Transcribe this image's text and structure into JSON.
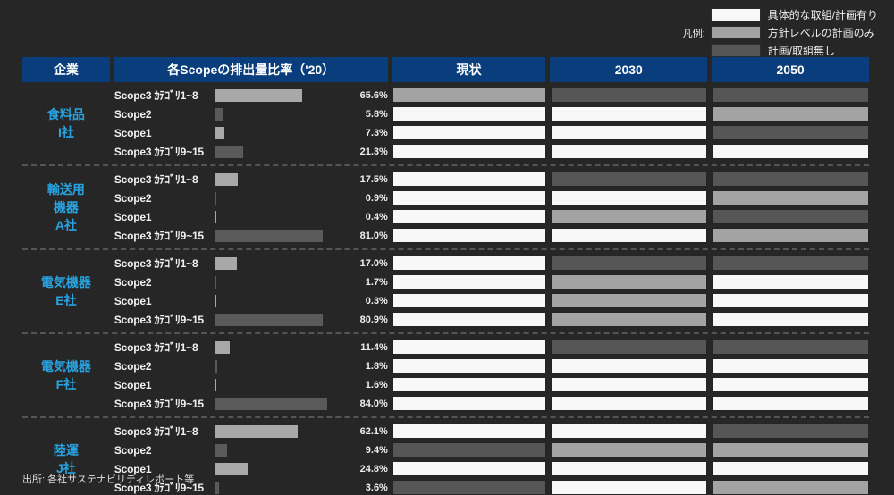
{
  "legend": {
    "label": "凡例:",
    "items": [
      {
        "text": "具体的な取組/計画有り",
        "color": "#f8f8f8"
      },
      {
        "text": "方針レベルの計画のみ",
        "color": "#a3a3a3"
      },
      {
        "text": "計画/取組無し",
        "color": "#565656"
      }
    ]
  },
  "colors": {
    "header_blue": "#0a3d7c",
    "company_label": "#29a3e0",
    "background": "#262626",
    "bar_light": "#a8a8a8",
    "bar_dark": "#5a5a5a",
    "status_yes": "#f8f8f8",
    "status_policy": "#a3a3a3",
    "status_none": "#565656"
  },
  "headers": {
    "company": "企業",
    "chart": "各Scopeの排出量比率（'20）",
    "now": "現状",
    "y2030": "2030",
    "y2050": "2050"
  },
  "source": "出所: 各社サステナビリティレポート等",
  "chart_data": {
    "type": "bar",
    "title": "各Scopeの排出量比率（'20）",
    "xlabel": "",
    "ylabel": "",
    "xlim": [
      0,
      100
    ],
    "grid": false,
    "orientation": "horizontal",
    "categories": [
      "Scope3 ｶﾃｺﾞﾘ1~8",
      "Scope2",
      "Scope1",
      "Scope3 ｶﾃｺﾞﾘ9~15"
    ],
    "groups": [
      {
        "company": [
          "食料品",
          "I社"
        ],
        "rows": [
          {
            "label": "Scope3 ｶﾃｺﾞﾘ1~8",
            "value": 65.6,
            "value_text": "65.6%",
            "bar_color": "#a8a8a8",
            "now": "#a3a3a3",
            "y2030": "#565656",
            "y2050": "#565656"
          },
          {
            "label": "Scope2",
            "value": 5.8,
            "value_text": "5.8%",
            "bar_color": "#5a5a5a",
            "now": "#f8f8f8",
            "y2030": "#f8f8f8",
            "y2050": "#a3a3a3"
          },
          {
            "label": "Scope1",
            "value": 7.3,
            "value_text": "7.3%",
            "bar_color": "#a8a8a8",
            "now": "#f8f8f8",
            "y2030": "#f8f8f8",
            "y2050": "#565656"
          },
          {
            "label": "Scope3 ｶﾃｺﾞﾘ9~15",
            "value": 21.3,
            "value_text": "21.3%",
            "bar_color": "#5a5a5a",
            "now": "#f8f8f8",
            "y2030": "#f8f8f8",
            "y2050": "#f8f8f8"
          }
        ]
      },
      {
        "company": [
          "輸送用",
          "機器",
          "A社"
        ],
        "rows": [
          {
            "label": "Scope3 ｶﾃｺﾞﾘ1~8",
            "value": 17.5,
            "value_text": "17.5%",
            "bar_color": "#a8a8a8",
            "now": "#f8f8f8",
            "y2030": "#565656",
            "y2050": "#565656"
          },
          {
            "label": "Scope2",
            "value": 0.9,
            "value_text": "0.9%",
            "bar_color": "#5a5a5a",
            "now": "#f8f8f8",
            "y2030": "#f8f8f8",
            "y2050": "#a3a3a3"
          },
          {
            "label": "Scope1",
            "value": 0.4,
            "value_text": "0.4%",
            "bar_color": "#a8a8a8",
            "now": "#f8f8f8",
            "y2030": "#a3a3a3",
            "y2050": "#565656"
          },
          {
            "label": "Scope3 ｶﾃｺﾞﾘ9~15",
            "value": 81.0,
            "value_text": "81.0%",
            "bar_color": "#5a5a5a",
            "now": "#f8f8f8",
            "y2030": "#f8f8f8",
            "y2050": "#a3a3a3"
          }
        ]
      },
      {
        "company": [
          "電気機器",
          "E社"
        ],
        "rows": [
          {
            "label": "Scope3 ｶﾃｺﾞﾘ1~8",
            "value": 17.0,
            "value_text": "17.0%",
            "bar_color": "#a8a8a8",
            "now": "#f8f8f8",
            "y2030": "#565656",
            "y2050": "#565656"
          },
          {
            "label": "Scope2",
            "value": 1.7,
            "value_text": "1.7%",
            "bar_color": "#5a5a5a",
            "now": "#f8f8f8",
            "y2030": "#a3a3a3",
            "y2050": "#f8f8f8"
          },
          {
            "label": "Scope1",
            "value": 0.3,
            "value_text": "0.3%",
            "bar_color": "#a8a8a8",
            "now": "#f8f8f8",
            "y2030": "#a3a3a3",
            "y2050": "#f8f8f8"
          },
          {
            "label": "Scope3 ｶﾃｺﾞﾘ9~15",
            "value": 80.9,
            "value_text": "80.9%",
            "bar_color": "#5a5a5a",
            "now": "#f8f8f8",
            "y2030": "#a3a3a3",
            "y2050": "#f8f8f8"
          }
        ]
      },
      {
        "company": [
          "電気機器",
          "F社"
        ],
        "rows": [
          {
            "label": "Scope3 ｶﾃｺﾞﾘ1~8",
            "value": 11.4,
            "value_text": "11.4%",
            "bar_color": "#a8a8a8",
            "now": "#f8f8f8",
            "y2030": "#565656",
            "y2050": "#565656"
          },
          {
            "label": "Scope2",
            "value": 1.8,
            "value_text": "1.8%",
            "bar_color": "#5a5a5a",
            "now": "#f8f8f8",
            "y2030": "#f8f8f8",
            "y2050": "#f8f8f8"
          },
          {
            "label": "Scope1",
            "value": 1.6,
            "value_text": "1.6%",
            "bar_color": "#a8a8a8",
            "now": "#f8f8f8",
            "y2030": "#f8f8f8",
            "y2050": "#f8f8f8"
          },
          {
            "label": "Scope3 ｶﾃｺﾞﾘ9~15",
            "value": 84.0,
            "value_text": "84.0%",
            "bar_color": "#5a5a5a",
            "now": "#f8f8f8",
            "y2030": "#f8f8f8",
            "y2050": "#f8f8f8"
          }
        ]
      },
      {
        "company": [
          "陸運",
          "J社"
        ],
        "rows": [
          {
            "label": "Scope3 ｶﾃｺﾞﾘ1~8",
            "value": 62.1,
            "value_text": "62.1%",
            "bar_color": "#a8a8a8",
            "now": "#f8f8f8",
            "y2030": "#f8f8f8",
            "y2050": "#565656"
          },
          {
            "label": "Scope2",
            "value": 9.4,
            "value_text": "9.4%",
            "bar_color": "#5a5a5a",
            "now": "#565656",
            "y2030": "#a3a3a3",
            "y2050": "#a3a3a3"
          },
          {
            "label": "Scope1",
            "value": 24.8,
            "value_text": "24.8%",
            "bar_color": "#a8a8a8",
            "now": "#f8f8f8",
            "y2030": "#f8f8f8",
            "y2050": "#f8f8f8"
          },
          {
            "label": "Scope3 ｶﾃｺﾞﾘ9~15",
            "value": 3.6,
            "value_text": "3.6%",
            "bar_color": "#5a5a5a",
            "now": "#565656",
            "y2030": "#f8f8f8",
            "y2050": "#a3a3a3"
          }
        ]
      }
    ]
  }
}
